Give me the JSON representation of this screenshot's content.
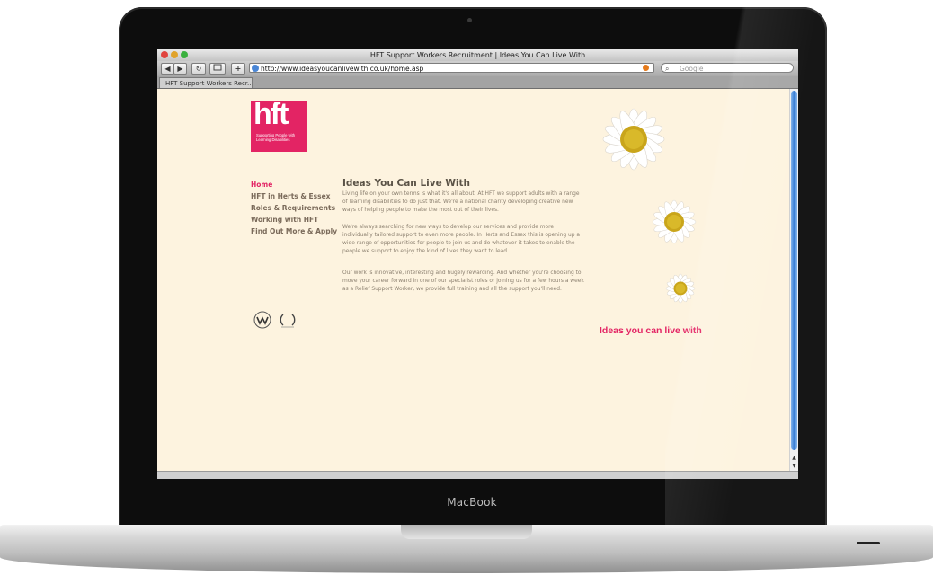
{
  "device": {
    "brand": "MacBook"
  },
  "browser": {
    "window_title": "HFT Support Workers Recruitment | Ideas You Can Live With",
    "url": "http://www.ideasyoucanlivewith.co.uk/home.asp",
    "search_placeholder": "Google",
    "tab_label": "HFT Support Workers Recr...",
    "toolbar": {
      "back": "◀",
      "forward": "▶",
      "reload": "↻",
      "bookmark": "+"
    }
  },
  "page": {
    "logo": {
      "letters": "hft",
      "subtitle": "Supporting People with Learning Disabilities"
    },
    "nav": [
      {
        "label": "Home",
        "active": true
      },
      {
        "label": "HFT in Herts & Essex",
        "active": false
      },
      {
        "label": "Roles & Requirements",
        "active": false
      },
      {
        "label": "Working with HFT",
        "active": false
      },
      {
        "label": "Find Out More & Apply",
        "active": false
      }
    ],
    "heading": "Ideas You Can Live With",
    "paragraphs": [
      "Living life on your own terms is what it's all about. At HFT we support adults with a range of learning disabilities to do just that. We're a national charity developing creative new ways of helping people to make the most out of their lives.",
      "We're always searching for new ways to develop our services and provide more individually tailored support to even more people. In Herts and Essex this is opening up a wide range of opportunities for people to join us and do whatever it takes to enable the people we support to enjoy the kind of lives they want to lead.",
      "Our work is innovative, interesting and hugely rewarding. And whether you're choosing to move your career forward in one of our specialist roles or joining us for a few hours a week as a Relief Support Worker, we provide full training and all the support you'll need."
    ],
    "tagline": "Ideas you can live with",
    "colors": {
      "brand": "#e32464",
      "background": "#fdf3df",
      "text": "#8c8070"
    }
  }
}
